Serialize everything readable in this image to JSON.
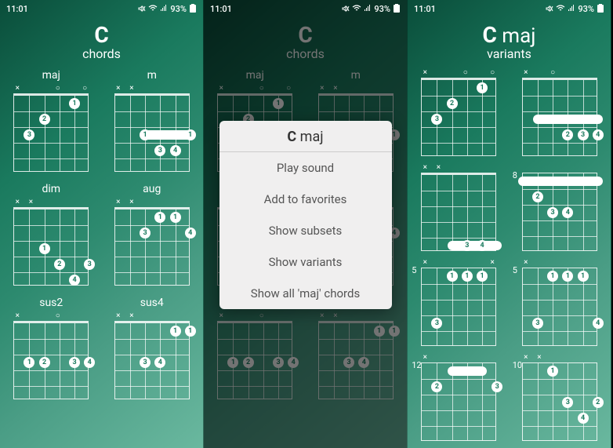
{
  "status": {
    "time": "11:01",
    "battery": "93%"
  },
  "screen1": {
    "title_note": "C",
    "title_sub": "chords",
    "chords": [
      {
        "label": "maj",
        "nut": [
          "×",
          "",
          "",
          "○",
          "",
          "○"
        ],
        "dots": [
          {
            "s": 1,
            "f": 3,
            "n": "3"
          },
          {
            "s": 2,
            "f": 2,
            "n": "2"
          },
          {
            "s": 4,
            "f": 1,
            "n": "1"
          }
        ]
      },
      {
        "label": "m",
        "nut": [
          "×",
          "×",
          "",
          "",
          "",
          ""
        ],
        "barre": {
          "from": 2,
          "to": 5,
          "f": 3
        },
        "dots": [
          {
            "s": 3,
            "f": 4,
            "n": "3"
          },
          {
            "s": 4,
            "f": 4,
            "n": "4"
          },
          {
            "s": 5,
            "f": 3,
            "n": "1"
          },
          {
            "s": 2,
            "f": 3,
            "n": "1"
          }
        ]
      },
      {
        "label": "dim",
        "nut": [
          "×",
          "×",
          "",
          "",
          "",
          ""
        ],
        "dots": [
          {
            "s": 2,
            "f": 3,
            "n": "1"
          },
          {
            "s": 3,
            "f": 4,
            "n": "2"
          },
          {
            "s": 4,
            "f": 5,
            "n": "4"
          },
          {
            "s": 5,
            "f": 4,
            "n": "3"
          }
        ]
      },
      {
        "label": "aug",
        "nut": [
          "×",
          "×",
          "",
          "",
          "",
          ""
        ],
        "dots": [
          {
            "s": 2,
            "f": 2,
            "n": "3"
          },
          {
            "s": 3,
            "f": 1,
            "n": "1"
          },
          {
            "s": 4,
            "f": 1,
            "n": "1"
          },
          {
            "s": 5,
            "f": 2,
            "n": "4"
          }
        ]
      },
      {
        "label": "sus2",
        "nut": [
          "×",
          "",
          "",
          "○",
          "",
          ""
        ],
        "dots": [
          {
            "s": 1,
            "f": 3,
            "n": "1"
          },
          {
            "s": 2,
            "f": 3,
            "n": "2"
          },
          {
            "s": 4,
            "f": 3,
            "n": "3"
          },
          {
            "s": 5,
            "f": 3,
            "n": "4"
          }
        ]
      },
      {
        "label": "sus4",
        "nut": [
          "×",
          "×",
          "",
          "",
          "",
          ""
        ],
        "dots": [
          {
            "s": 2,
            "f": 3,
            "n": "3"
          },
          {
            "s": 3,
            "f": 3,
            "n": "4"
          },
          {
            "s": 4,
            "f": 1,
            "n": "1"
          },
          {
            "s": 5,
            "f": 1,
            "n": "1"
          }
        ]
      }
    ]
  },
  "screen2": {
    "title_note": "C",
    "title_sub": "chords",
    "popup": {
      "title_bold": "C",
      "title_rest": " maj",
      "items": [
        "Play sound",
        "Add to favorites",
        "Show subsets",
        "Show variants",
        "Show all 'maj' chords"
      ]
    }
  },
  "screen3": {
    "title_note": "C",
    "title_quality": " maj",
    "title_sub": "variants",
    "variants": [
      {
        "fret": "",
        "nut": [
          "×",
          "",
          "",
          "○",
          "",
          "○"
        ],
        "nonut": false,
        "dots": [
          {
            "s": 1,
            "f": 3,
            "n": "3"
          },
          {
            "s": 2,
            "f": 2,
            "n": "2"
          },
          {
            "s": 4,
            "f": 1,
            "n": "1"
          }
        ]
      },
      {
        "fret": "",
        "nut": [
          "×",
          "",
          "○",
          "",
          "",
          ""
        ],
        "nonut": false,
        "barre": {
          "from": 1,
          "to": 5,
          "f": 3
        },
        "dots": [
          {
            "s": 3,
            "f": 4,
            "n": "2"
          },
          {
            "s": 4,
            "f": 4,
            "n": "3"
          },
          {
            "s": 5,
            "f": 4,
            "n": "4"
          }
        ]
      },
      {
        "fret": "",
        "nut": [
          "×",
          "×",
          "",
          "",
          "",
          ""
        ],
        "nonut": false,
        "barre": {
          "from": 2,
          "to": 5,
          "f": 5
        },
        "dots": [
          {
            "s": 3,
            "f": 5,
            "n": "3"
          },
          {
            "s": 4,
            "f": 5,
            "n": "4"
          }
        ]
      },
      {
        "fret": "8",
        "nut": [
          "",
          "",
          "",
          "",
          "",
          ""
        ],
        "nonut": true,
        "barre": {
          "from": 0,
          "to": 5,
          "f": 1
        },
        "dots": [
          {
            "s": 2,
            "f": 3,
            "n": "3"
          },
          {
            "s": 3,
            "f": 3,
            "n": "4"
          },
          {
            "s": 1,
            "f": 2,
            "n": "2"
          }
        ]
      },
      {
        "fret": "5",
        "nut": [
          "×",
          "",
          "",
          "",
          "",
          "×"
        ],
        "nonut": true,
        "dots": [
          {
            "s": 1,
            "f": 4,
            "n": "3"
          },
          {
            "s": 2,
            "f": 1,
            "n": "1"
          },
          {
            "s": 3,
            "f": 1,
            "n": "1"
          },
          {
            "s": 4,
            "f": 1,
            "n": "1"
          }
        ]
      },
      {
        "fret": "5",
        "nut": [
          "×",
          "",
          "",
          "",
          "",
          ""
        ],
        "nonut": true,
        "dots": [
          {
            "s": 1,
            "f": 4,
            "n": "3"
          },
          {
            "s": 2,
            "f": 1,
            "n": "1"
          },
          {
            "s": 3,
            "f": 1,
            "n": "1"
          },
          {
            "s": 4,
            "f": 1,
            "n": "1"
          },
          {
            "s": 5,
            "f": 4,
            "n": "4"
          }
        ]
      },
      {
        "fret": "12",
        "nut": [
          "×",
          "",
          "",
          "",
          "",
          ""
        ],
        "nonut": true,
        "barre": {
          "from": 2,
          "to": 4,
          "f": 1
        },
        "dots": [
          {
            "s": 1,
            "f": 2,
            "n": "2"
          },
          {
            "s": 5,
            "f": 2,
            "n": "3"
          }
        ]
      },
      {
        "fret": "10",
        "nut": [
          "×",
          "×",
          "",
          "",
          "",
          ""
        ],
        "nonut": true,
        "dots": [
          {
            "s": 2,
            "f": 1,
            "n": "1"
          },
          {
            "s": 3,
            "f": 3,
            "n": "3"
          },
          {
            "s": 4,
            "f": 4,
            "n": "4"
          },
          {
            "s": 5,
            "f": 3,
            "n": "2"
          }
        ]
      }
    ]
  }
}
